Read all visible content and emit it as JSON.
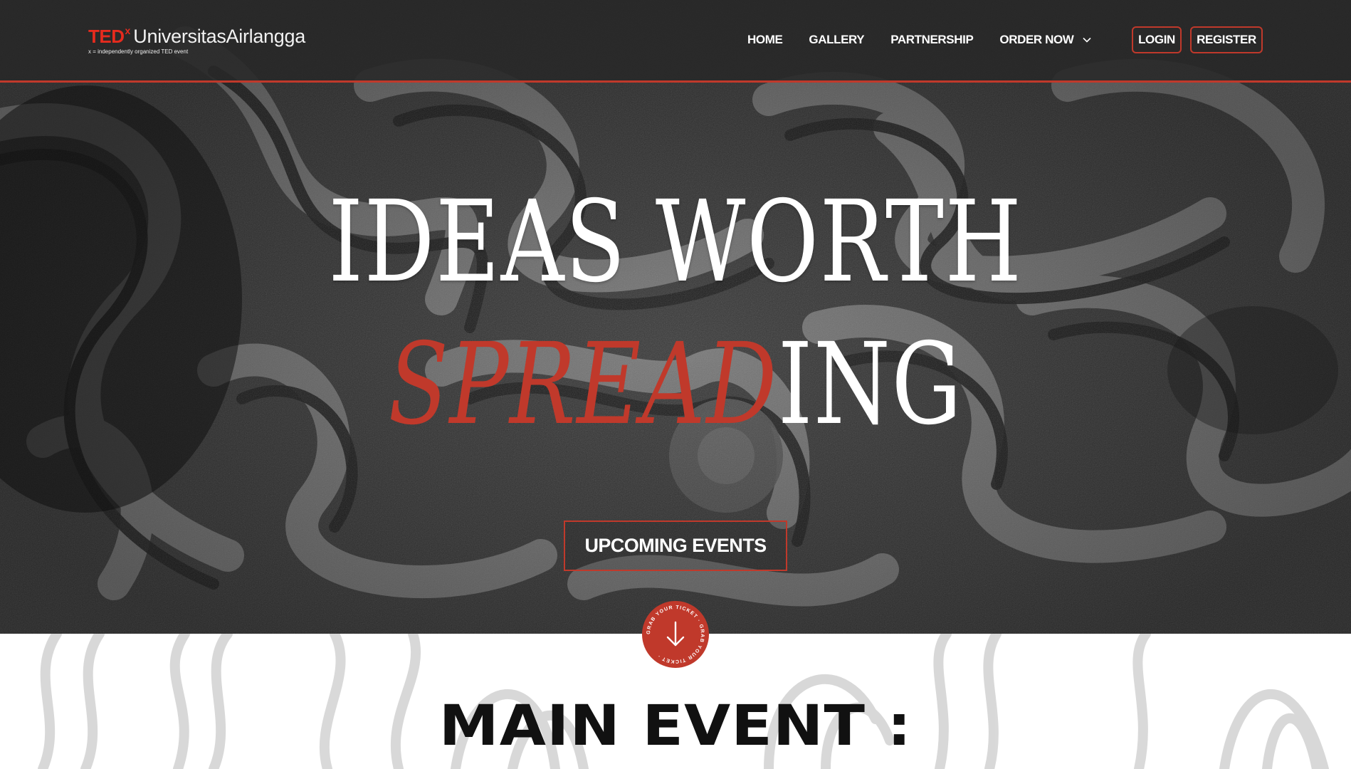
{
  "brand": {
    "ted": "TED",
    "x": "x",
    "name": "UniversitasAirlangga",
    "subtitle": "x = independently organized TED event"
  },
  "nav": {
    "items": [
      "HOME",
      "GALLERY",
      "PARTNERSHIP"
    ],
    "order_label": "ORDER NOW",
    "login_label": "LOGIN",
    "register_label": "REGISTER"
  },
  "hero": {
    "line1": "IDEAS WORTH",
    "line2_red": "SPREAD",
    "line2_white": "ING",
    "cta_label": "UPCOMING EVENTS",
    "badge_text": "GRAB YOUR TICKET · GRAB YOUR TICKET ·",
    "badge_icon": "arrow-down-icon"
  },
  "section": {
    "title": "MAIN EVENT :"
  },
  "colors": {
    "accent": "#c0392b",
    "ted_red": "#e62b1e",
    "nav_bg": "#282828"
  }
}
